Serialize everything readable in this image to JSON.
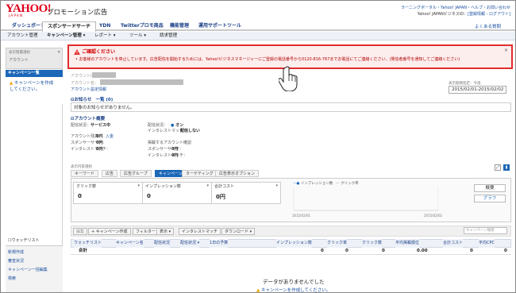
{
  "header": {
    "logo": "YAHOO!",
    "logo_sub": "JAPAN",
    "app_title": "プロモーション広告",
    "links_line1": "ラーニングポータル・Yahoo! JAPAN・ヘルプ・お問い合わせ",
    "links_line2_user": "Yahoo! JAPANビジネスID：",
    "links_line2_actions": "[登録情報 - ログアウト]"
  },
  "tabs": [
    "ダッシュボード",
    "スポンサードサーチ",
    "YDN",
    "Twitterプロモ商品",
    "機能管理",
    "運用サポートツール"
  ],
  "help_link": "よくある質問",
  "subnav": [
    "アカウント管理",
    "キャンペーン管理 ▾",
    "レポート ▾",
    "ツール ▾",
    "請求管理"
  ],
  "sidebar": {
    "head_label": "表示階層選択",
    "account_label": "アカウント",
    "collapse": "«",
    "campaign_list": "キャンペーン一覧",
    "create_campaign": "キャンペーンを作成してください。",
    "watchlist": "ウォッチリスト",
    "bottom": [
      "新規作成",
      "審査状況",
      "キャンペーン一括編集",
      "検索"
    ]
  },
  "alert": {
    "title": "ご確認ください",
    "message": "• お客様のアカウントを停止しています。広告配信を開始するためには、Yahoo!ビジネスマネージャーにご登録の電話番号から0120-816-767までお電話にてご連絡ください。(発信者番号を通知してご連絡ください)",
    "close": "×"
  },
  "account": {
    "id_label": "アカウントID：",
    "name_label": "アカウント名：",
    "settings_link": "アカウント設定情報",
    "range_label": "表示期間指定：今週",
    "range_value": "2015/02/01-2015/02/02"
  },
  "notices": {
    "title": "お知らせ",
    "link": "一覧 (0)",
    "body": "対象のお知らせがありません。"
  },
  "overview": {
    "title": "アカウント概要",
    "labels_left": [
      "配信状況：",
      "アカウント残高：",
      "スポンサーサーチ：",
      "インタレストマッチ："
    ],
    "values_left": [
      "サービス中",
      "0円",
      "0円",
      "0円"
    ],
    "deposit_link": "入金",
    "labels_right": [
      "配信状況：",
      "インタレストマッチ：",
      "掲載するアカウント確認",
      "スポンサーサーチ：",
      "インタレストマッチ："
    ],
    "values_right": [
      "オン",
      "配信しない",
      "",
      "0円",
      "0円"
    ]
  },
  "perf": {
    "label": "表示内容選択",
    "tabs": [
      "キーワード",
      "広告",
      "広告グループ",
      "キャンペーン",
      "ターゲティング",
      "広告表示オプション"
    ],
    "metrics": [
      {
        "label": "クリック数",
        "value": "0"
      },
      {
        "label": "インプレッション数",
        "value": "0"
      },
      {
        "label": "合計コスト",
        "value": "0円"
      }
    ],
    "legend_impr": "インプレッション数",
    "legend_click": "クリック率",
    "x_start": "2015/02/01",
    "x_end": "2015/02/02",
    "side_buttons": [
      "概要",
      "グラフ"
    ]
  },
  "table": {
    "toolbar": [
      "編集",
      "+ キャンペーン作成",
      "フィルター",
      "表示 ▾",
      "インタレストマッチ",
      "ダウンロード ▾"
    ],
    "search_placeholder": "キャンペーン検索",
    "columns": [
      "ウォッチリスト",
      "キャンペーン名",
      "配信状況",
      "配信状況 ▾",
      "1日の予算",
      "インプレッション数",
      "クリック率",
      "クリック数",
      "平均掲載順位",
      "合計コスト",
      "平均CPC"
    ],
    "total_label": "合計",
    "totals": [
      "0",
      "0",
      "0",
      "0.00",
      "0",
      "0"
    ],
    "empty_message": "データがありませんでした",
    "empty_sub": "キャンペーンを作成してください。"
  },
  "colors": {
    "alert_border": "#e32b2b",
    "primary": "#1b67b8",
    "link": "#1a4fa0"
  }
}
